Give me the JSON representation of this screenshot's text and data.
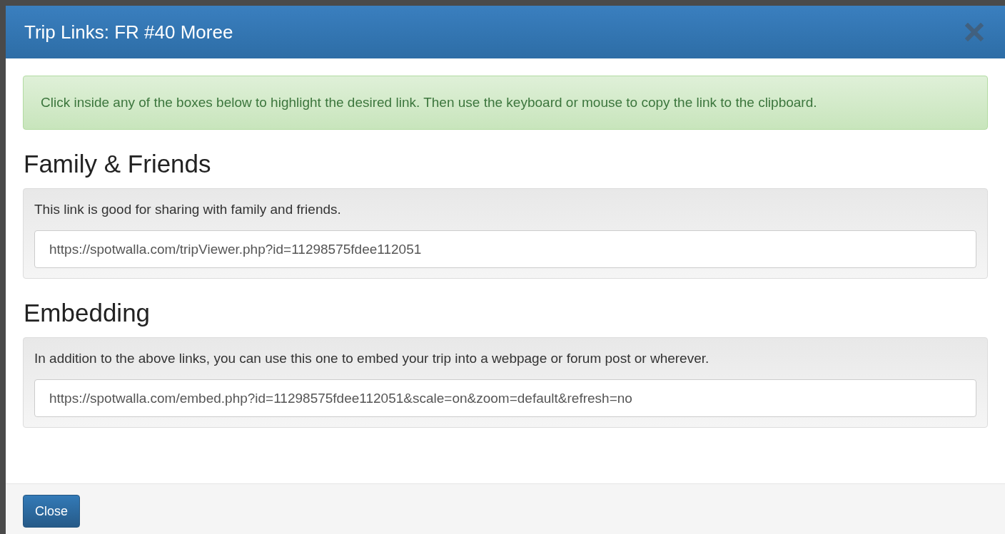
{
  "dialog": {
    "title": "Trip Links: FR #40 Moree"
  },
  "alert": {
    "text": "Click inside any of the boxes below to highlight the desired link. Then use the keyboard or mouse to copy the link to the clipboard."
  },
  "sections": [
    {
      "heading": "Family & Friends",
      "description": "This link is good for sharing with family and friends.",
      "value": "https://spotwalla.com/tripViewer.php?id=11298575fdee112051"
    },
    {
      "heading": "Embedding",
      "description": "In addition to the above links, you can use this one to embed your trip into a webpage or forum post or wherever.",
      "value": "https://spotwalla.com/embed.php?id=11298575fdee112051&scale=on&zoom=default&refresh=no"
    }
  ],
  "footer": {
    "buttons": [
      "Close"
    ]
  }
}
